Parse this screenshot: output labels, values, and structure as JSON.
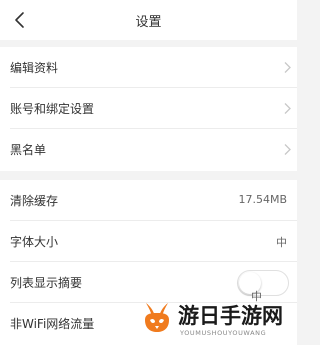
{
  "nav": {
    "title": "设置"
  },
  "group1": [
    {
      "label": "编辑资料"
    },
    {
      "label": "账号和绑定设置"
    },
    {
      "label": "黑名单"
    }
  ],
  "group2": [
    {
      "label": "清除缓存",
      "value": "17.54MB"
    },
    {
      "label": "字体大小",
      "value": "中"
    },
    {
      "label": "列表显示摘要",
      "value": "中"
    },
    {
      "label": "非WiFi网络流量"
    }
  ],
  "watermark": {
    "text": "游日手游网",
    "sub": "YOUMUSHOUYOUWANG"
  },
  "colors": {
    "accent": "#f5a623",
    "logo_orange": "#f07b1e"
  }
}
